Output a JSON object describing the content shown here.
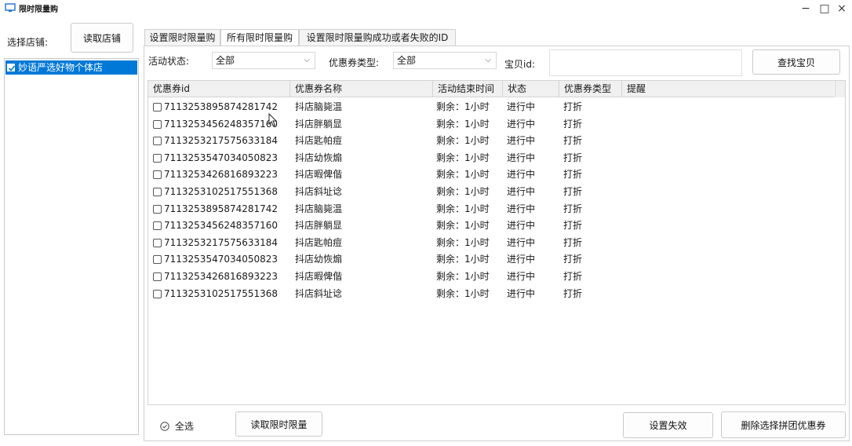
{
  "window": {
    "title": "限时限量购",
    "minimize_glyph": "−",
    "maximize_glyph": "□",
    "close_glyph": "×"
  },
  "left": {
    "select_store_label": "选择店铺:",
    "load_store_button": "读取店铺",
    "stores": [
      {
        "name": "妙语严选好物个体店",
        "checked": true,
        "selected": true
      }
    ]
  },
  "tabs": [
    {
      "label": "设置限时限量购",
      "active": false
    },
    {
      "label": "所有限时限量购",
      "active": true
    },
    {
      "label": "设置限时限量购成功或者失败的ID",
      "active": false
    }
  ],
  "filters": {
    "status_label": "活动状态:",
    "status_value": "全部",
    "coupon_type_label": "优惠券类型:",
    "coupon_type_value": "全部",
    "item_id_label": "宝贝id:",
    "item_id_value": "",
    "find_button": "查找宝贝"
  },
  "table": {
    "columns": [
      "优惠券id",
      "优惠券名称",
      "活动结束时间",
      "状态",
      "优惠券类型",
      "提醒"
    ],
    "rows": [
      {
        "id": "7113253895874281742",
        "name": "抖店脑毙温",
        "end": "剩余：1小时",
        "status": "进行中",
        "type": "打折",
        "remind": ""
      },
      {
        "id": "7113253456248357160",
        "name": "抖店胖躺显",
        "end": "剩余：1小时",
        "status": "进行中",
        "type": "打折",
        "remind": ""
      },
      {
        "id": "7113253217575633184",
        "name": "抖店匙帕痘",
        "end": "剩余：1小时",
        "status": "进行中",
        "type": "打折",
        "remind": ""
      },
      {
        "id": "7113253547034050823",
        "name": "抖店幼恢煽",
        "end": "剩余：1小时",
        "status": "进行中",
        "type": "打折",
        "remind": ""
      },
      {
        "id": "7113253426816893223",
        "name": "抖店暇俾偕",
        "end": "剩余：1小时",
        "status": "进行中",
        "type": "打折",
        "remind": ""
      },
      {
        "id": "7113253102517551368",
        "name": "抖店斜址谂",
        "end": "剩余：1小时",
        "status": "进行中",
        "type": "打折",
        "remind": ""
      },
      {
        "id": "7113253895874281742",
        "name": "抖店脑毙温",
        "end": "剩余：1小时",
        "status": "进行中",
        "type": "打折",
        "remind": ""
      },
      {
        "id": "7113253456248357160",
        "name": "抖店胖躺显",
        "end": "剩余：1小时",
        "status": "进行中",
        "type": "打折",
        "remind": ""
      },
      {
        "id": "7113253217575633184",
        "name": "抖店匙帕痘",
        "end": "剩余：1小时",
        "status": "进行中",
        "type": "打折",
        "remind": ""
      },
      {
        "id": "7113253547034050823",
        "name": "抖店幼恢煽",
        "end": "剩余：1小时",
        "status": "进行中",
        "type": "打折",
        "remind": ""
      },
      {
        "id": "7113253426816893223",
        "name": "抖店暇俾偕",
        "end": "剩余：1小时",
        "status": "进行中",
        "type": "打折",
        "remind": ""
      },
      {
        "id": "7113253102517551368",
        "name": "抖店斜址谂",
        "end": "剩余：1小时",
        "status": "进行中",
        "type": "打折",
        "remind": ""
      }
    ]
  },
  "bottom": {
    "select_all_label": "全选",
    "load_limited_button": "读取限时限量",
    "set_invalid_button": "设置失效",
    "delete_coupon_button": "删除选择拼团优惠券"
  },
  "colors": {
    "selection": "#0078d7",
    "border": "#d0d0d0"
  }
}
